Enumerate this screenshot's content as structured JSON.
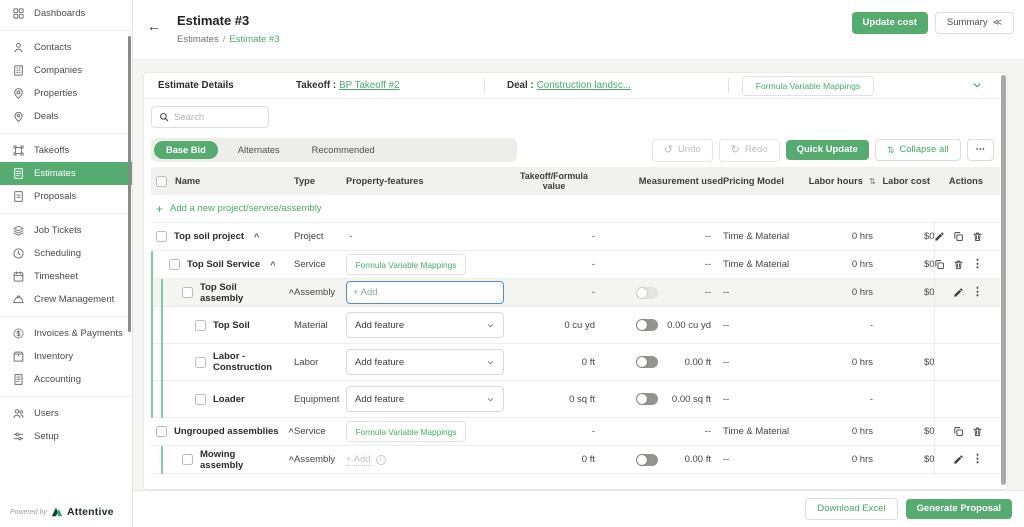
{
  "app": {
    "accent": "#55ab70"
  },
  "sidebar": {
    "groups": [
      {
        "items": [
          {
            "label": "Dashboards",
            "icon": "dashboards-icon"
          }
        ]
      },
      {
        "items": [
          {
            "label": "Contacts",
            "icon": "contacts-icon"
          },
          {
            "label": "Companies",
            "icon": "companies-icon"
          },
          {
            "label": "Properties",
            "icon": "properties-icon"
          },
          {
            "label": "Deals",
            "icon": "deals-icon"
          }
        ]
      },
      {
        "items": [
          {
            "label": "Takeoffs",
            "icon": "takeoffs-icon"
          },
          {
            "label": "Estimates",
            "icon": "estimates-icon",
            "active": true
          },
          {
            "label": "Proposals",
            "icon": "proposals-icon"
          }
        ]
      },
      {
        "items": [
          {
            "label": "Job Tickets",
            "icon": "job-tickets-icon"
          },
          {
            "label": "Scheduling",
            "icon": "scheduling-icon"
          },
          {
            "label": "Timesheet",
            "icon": "timesheet-icon"
          },
          {
            "label": "Crew Management",
            "icon": "crew-management-icon"
          }
        ]
      },
      {
        "items": [
          {
            "label": "Invoices & Payments",
            "icon": "invoices-icon"
          },
          {
            "label": "Inventory",
            "icon": "inventory-icon"
          },
          {
            "label": "Accounting",
            "icon": "accounting-icon"
          }
        ]
      },
      {
        "items": [
          {
            "label": "Users",
            "icon": "users-icon"
          },
          {
            "label": "Setup",
            "icon": "setup-icon"
          }
        ]
      }
    ],
    "powered_by": "Powered by",
    "brand": "Attentive"
  },
  "header": {
    "title": "Estimate #3",
    "breadcrumb": [
      "Estimates",
      "Estimate #3"
    ],
    "update_cost_label": "Update cost",
    "summary_label": "Summary"
  },
  "details_bar": {
    "title": "Estimate Details",
    "takeoff_label": "Takeoff :",
    "takeoff_link": "BP Takeoff #2",
    "deal_label": "Deal :",
    "deal_link": "Construction landsc...",
    "fvm_label": "Formula Variable Mappings"
  },
  "toolbar": {
    "search_placeholder": "Search",
    "tabs": [
      {
        "label": "Base Bid",
        "active": true
      },
      {
        "label": "Alternates",
        "active": false
      },
      {
        "label": "Recommended",
        "active": false
      }
    ],
    "undo_label": "Undo",
    "redo_label": "Redo",
    "quick_update_label": "Quick Update",
    "collapse_all_label": "Collapse all",
    "more_label": "⋯"
  },
  "table": {
    "columns": [
      "Name",
      "Type",
      "Property-features",
      "Takeoff/Formula value",
      "Measurement used",
      "Pricing Model",
      "Labor hours",
      "Labor cost",
      "Actions"
    ],
    "add_row_label": "Add a new project/service/assembly",
    "rows": [
      {
        "name": "Top soil project",
        "caret": true,
        "indent": 0,
        "type": "Project",
        "feature": {
          "kind": "text",
          "label": "-"
        },
        "takeoff": "-",
        "toggle": null,
        "measurement": "--",
        "pricing": "Time & Material",
        "labor_hours": "0 hrs",
        "labor_cost": "$0",
        "actions": [
          "edit",
          "copy",
          "delete"
        ],
        "highlighted": false
      },
      {
        "name": "Top Soil Service",
        "caret": true,
        "indent": 1,
        "type": "Service",
        "feature": {
          "kind": "button",
          "label": "Formula Variable Mappings"
        },
        "takeoff": "-",
        "toggle": null,
        "measurement": "--",
        "pricing": "Time & Material",
        "labor_hours": "0 hrs",
        "labor_cost": "$0",
        "actions": [
          "copy",
          "delete",
          "kebab"
        ],
        "highlighted": false
      },
      {
        "name": "Top Soil assembly",
        "caret": true,
        "indent": 2,
        "type": "Assembly",
        "feature": {
          "kind": "add-input",
          "label": "+ Add"
        },
        "takeoff": "-",
        "toggle": "light",
        "measurement": "--",
        "pricing": "--",
        "labor_hours": "0 hrs",
        "labor_cost": "$0",
        "actions": [
          "edit",
          "kebab"
        ],
        "highlighted": true
      },
      {
        "name": "Top Soil",
        "caret": false,
        "indent": 3,
        "type": "Material",
        "feature": {
          "kind": "dropdown",
          "label": "Add feature"
        },
        "takeoff": "0 cu yd",
        "toggle": "dark",
        "measurement": "0.00 cu yd",
        "pricing": "--",
        "labor_hours": "-",
        "labor_cost": "",
        "actions": [],
        "highlighted": false
      },
      {
        "name": "Labor - Construction",
        "caret": false,
        "indent": 3,
        "type": "Labor",
        "feature": {
          "kind": "dropdown",
          "label": "Add feature"
        },
        "takeoff": "0 ft",
        "toggle": "dark",
        "measurement": "0.00 ft",
        "pricing": "--",
        "labor_hours": "0 hrs",
        "labor_cost": "$0",
        "actions": [],
        "highlighted": false
      },
      {
        "name": "Loader",
        "caret": false,
        "indent": 3,
        "type": "Equipment",
        "feature": {
          "kind": "dropdown",
          "label": "Add feature"
        },
        "takeoff": "0 sq ft",
        "toggle": "dark",
        "measurement": "0.00 sq ft",
        "pricing": "--",
        "labor_hours": "-",
        "labor_cost": "",
        "actions": [],
        "highlighted": false
      },
      {
        "name": "Ungrouped assemblies",
        "caret": true,
        "indent": 0,
        "type": "Service",
        "feature": {
          "kind": "button",
          "label": "Formula Variable Mappings"
        },
        "takeoff": "-",
        "toggle": null,
        "measurement": "--",
        "pricing": "Time & Material",
        "labor_hours": "0 hrs",
        "labor_cost": "$0",
        "actions": [
          "copy",
          "delete"
        ],
        "highlighted": false
      },
      {
        "name": "Mowing assembly",
        "caret": true,
        "indent": 2,
        "type": "Assembly",
        "feature": {
          "kind": "add-disabled",
          "label": "+ Add"
        },
        "takeoff": "0 ft",
        "toggle": "dark",
        "measurement": "0.00 ft",
        "pricing": "--",
        "labor_hours": "0 hrs",
        "labor_cost": "$0",
        "actions": [
          "edit",
          "kebab"
        ],
        "highlighted": false
      }
    ]
  },
  "footer": {
    "download_label": "Download Excel",
    "generate_label": "Generate Proposal"
  }
}
